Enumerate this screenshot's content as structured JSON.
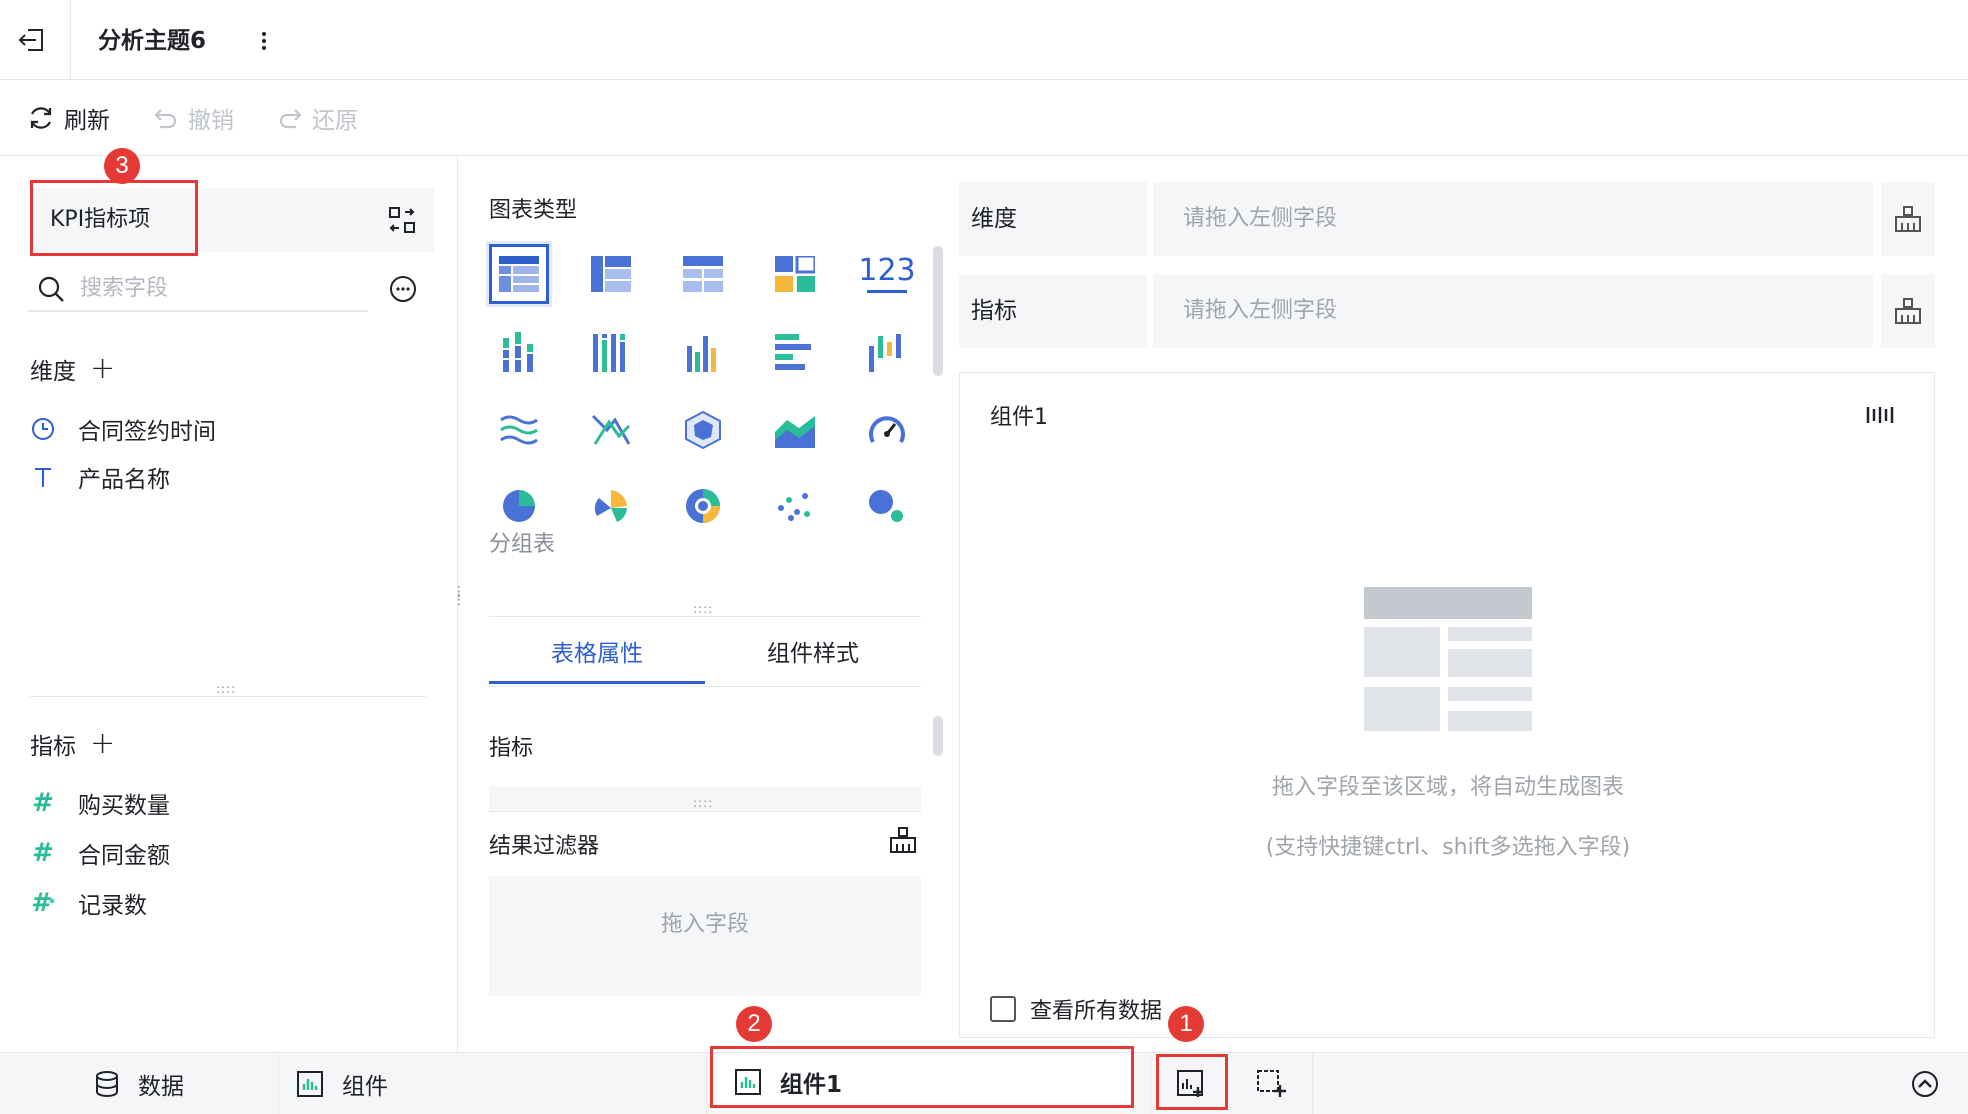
{
  "header": {
    "title": "分析主题6"
  },
  "toolbar": {
    "refresh": "刷新",
    "undo": "撤销",
    "redo": "还原"
  },
  "left": {
    "dataset": "KPI指标项",
    "search_placeholder": "搜索字段",
    "dimension_title": "维度",
    "dimension_plus": "+",
    "dimensions": [
      "合同签约时间",
      "产品名称"
    ],
    "metric_title": "指标",
    "metric_plus": "+",
    "metrics": [
      "购买数量",
      "合同金额",
      "记录数"
    ]
  },
  "middle": {
    "chart_type_title": "图表类型",
    "selected_chart": "分组表",
    "number_chart_label": "123",
    "tabs": [
      "表格属性",
      "组件样式"
    ],
    "metric_label": "指标",
    "filter_label": "结果过滤器",
    "drop_field": "拖入字段"
  },
  "right": {
    "dimension_label": "维度",
    "dimension_placeholder": "请拖入左侧字段",
    "metric_label": "指标",
    "metric_placeholder": "请拖入左侧字段",
    "component_title": "组件1",
    "hint_main": "拖入字段至该区域，将自动生成图表",
    "hint_sub": "(支持快捷键ctrl、shift多选拖入字段)",
    "view_all": "查看所有数据"
  },
  "bottom": {
    "data_tab": "数据",
    "component_tab": "组件",
    "component1_tab": "组件1"
  },
  "annotations": [
    "1",
    "2",
    "3"
  ],
  "colors": {
    "accent": "#2d5fcf",
    "annotation": "#e53935",
    "teal": "#2bbd9a"
  }
}
